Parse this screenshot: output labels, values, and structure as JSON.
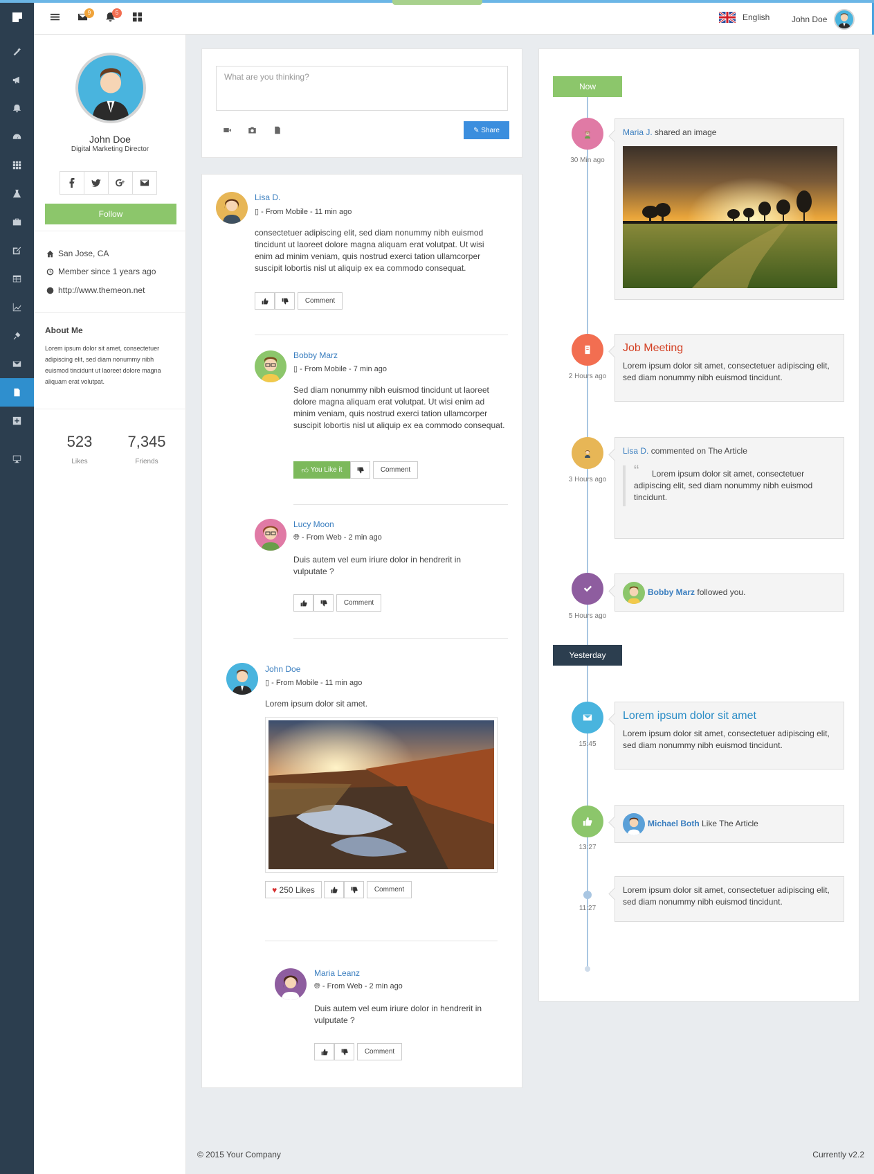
{
  "header": {
    "mail_badge": "9",
    "bell_badge": "5",
    "language": "English",
    "user_name": "John Doe",
    "colors": {
      "mail_badge": "#f0a33a",
      "bell_badge": "#f26e51"
    }
  },
  "sidebar": {
    "icons": [
      "magic-icon",
      "bullhorn-icon",
      "bell-icon",
      "dashboard-icon",
      "grid-icon",
      "flask-icon",
      "briefcase-icon",
      "edit-icon",
      "table-icon",
      "chart-icon",
      "plug-icon",
      "mail-icon",
      "file-icon",
      "plus-square-icon",
      "monitor-icon"
    ]
  },
  "profile": {
    "name": "John Doe",
    "title": "Digital Marketing Director",
    "follow_label": "Follow",
    "location": "San Jose, CA",
    "member_since": "Member since 1 years ago",
    "website": "http://www.themeon.net",
    "about_title": "About Me",
    "about_text": "Lorem ipsum dolor sit amet, consectetuer adipiscing elit, sed diam nonummy nibh euismod tincidunt ut laoreet dolore magna aliquam erat volutpat.",
    "likes_count": "523",
    "likes_label": "Likes",
    "friends_count": "7,345",
    "friends_label": "Friends"
  },
  "composer": {
    "placeholder": "What are you thinking?",
    "share_label": "Share"
  },
  "posts": [
    {
      "author": "Lisa D.",
      "meta": "- From Mobile - 11 min ago",
      "text": "consectetuer adipiscing elit, sed diam nonummy nibh euismod tincidunt ut laoreet dolore magna aliquam erat volutpat. Ut wisi enim ad minim veniam, quis nostrud exerci tation ullamcorper suscipit lobortis nisl ut aliquip ex ea commodo consequat.",
      "comment": "Comment"
    },
    {
      "author": "Bobby Marz",
      "meta": "- From Mobile - 7 min ago",
      "text": "Sed diam nonummy nibh euismod tincidunt ut laoreet dolore magna aliquam erat volutpat. Ut wisi enim ad minim veniam, quis nostrud exerci tation ullamcorper suscipit lobortis nisl ut aliquip ex ea commodo consequat.",
      "liked": "You Like it",
      "comment": "Comment"
    },
    {
      "author": "Lucy Moon",
      "meta": "- From Web - 2 min ago",
      "text": "Duis autem vel eum iriure dolor in hendrerit in vulputate ?",
      "comment": "Comment"
    },
    {
      "author": "John Doe",
      "meta": "- From Mobile - 11 min ago",
      "text": "Lorem ipsum dolor sit amet.",
      "likes": "250 Likes",
      "comment": "Comment"
    },
    {
      "author": "Maria Leanz",
      "meta": "- From Web - 2 min ago",
      "text": "Duis autem vel eum iriure dolor in hendrerit in vulputate ?",
      "comment": "Comment"
    }
  ],
  "timeline": {
    "now_label": "Now",
    "yesterday_label": "Yesterday",
    "items": [
      {
        "name": "Maria J.",
        "action": "shared an image",
        "time": "30 Min ago"
      },
      {
        "title": "Job Meeting",
        "text": "Lorem ipsum dolor sit amet, consectetuer adipiscing elit, sed diam nonummy nibh euismod tincidunt.",
        "time": "2 Hours ago"
      },
      {
        "name": "Lisa D.",
        "action": "commented on The Article",
        "quote": "Lorem ipsum dolor sit amet, consectetuer adipiscing elit, sed diam nonummy nibh euismod tincidunt.",
        "time": "3 Hours ago"
      },
      {
        "name": "Bobby Marz",
        "action": "followed you.",
        "time": "5 Hours ago"
      },
      {
        "title": "Lorem ipsum dolor sit amet",
        "text": "Lorem ipsum dolor sit amet, consectetuer adipiscing elit, sed diam nonummy nibh euismod tincidunt.",
        "time": "15:45"
      },
      {
        "name": "Michael Both",
        "action": "Like The Article",
        "time": "13:27"
      },
      {
        "text": "Lorem ipsum dolor sit amet, consectetuer adipiscing elit, sed diam nonummy nibh euismod tincidunt.",
        "time": "11:27"
      }
    ]
  },
  "footer": {
    "copyright": "© 2015 Your Company",
    "version": "Currently v2.2"
  }
}
